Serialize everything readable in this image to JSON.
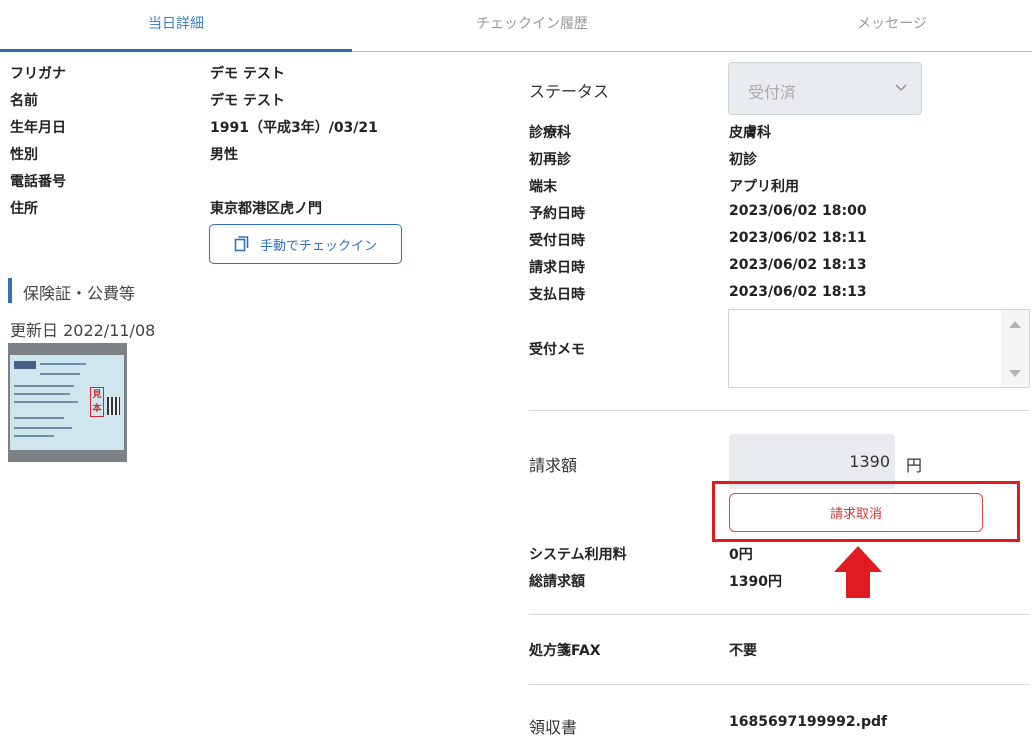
{
  "tabs": [
    {
      "label": "当日詳細",
      "active": true
    },
    {
      "label": "チェックイン履歴",
      "active": false
    },
    {
      "label": "メッセージ",
      "active": false
    }
  ],
  "patient": {
    "furigana_label": "フリガナ",
    "furigana": "デモ テスト",
    "name_label": "名前",
    "name": "デモ テスト",
    "birth_label": "生年月日",
    "birth": "1991（平成3年）/03/21",
    "sex_label": "性別",
    "sex": "男性",
    "phone_label": "電話番号",
    "phone": "",
    "address_label": "住所",
    "address": "東京都港区虎ノ門",
    "checkin_button": "手動でチェックイン"
  },
  "insurance": {
    "section_title": "保険証・公費等",
    "updated": "更新日 2022/11/08",
    "card_stamp": "見本"
  },
  "detail": {
    "status_label": "ステータス",
    "status_value": "受付済",
    "rows": [
      {
        "label": "診療科",
        "value": "皮膚科"
      },
      {
        "label": "初再診",
        "value": "初診"
      },
      {
        "label": "端末",
        "value": "アプリ利用"
      },
      {
        "label": "予約日時",
        "value": "2023/06/02 18:00"
      },
      {
        "label": "受付日時",
        "value": "2023/06/02 18:11"
      },
      {
        "label": "請求日時",
        "value": "2023/06/02 18:13"
      },
      {
        "label": "支払日時",
        "value": "2023/06/02 18:13"
      }
    ],
    "memo_label": "受付メモ",
    "memo_value": ""
  },
  "billing": {
    "label": "請求額",
    "amount": "1390",
    "unit": "円",
    "cancel_button": "請求取消",
    "system_fee_label": "システム利用料",
    "system_fee": "0円",
    "total_label": "総請求額",
    "total": "1390円"
  },
  "fax": {
    "label": "処方箋FAX",
    "value": "不要"
  },
  "receipt": {
    "label": "領収書",
    "file": "1685697199992.pdf"
  },
  "colors": {
    "accent": "#2f72b8",
    "danger": "#d63a3a",
    "highlight": "#e11b22"
  },
  "icons": {
    "checkin": "copy-icon",
    "select": "chevron-down-icon",
    "annotation": "up-arrow-icon"
  }
}
